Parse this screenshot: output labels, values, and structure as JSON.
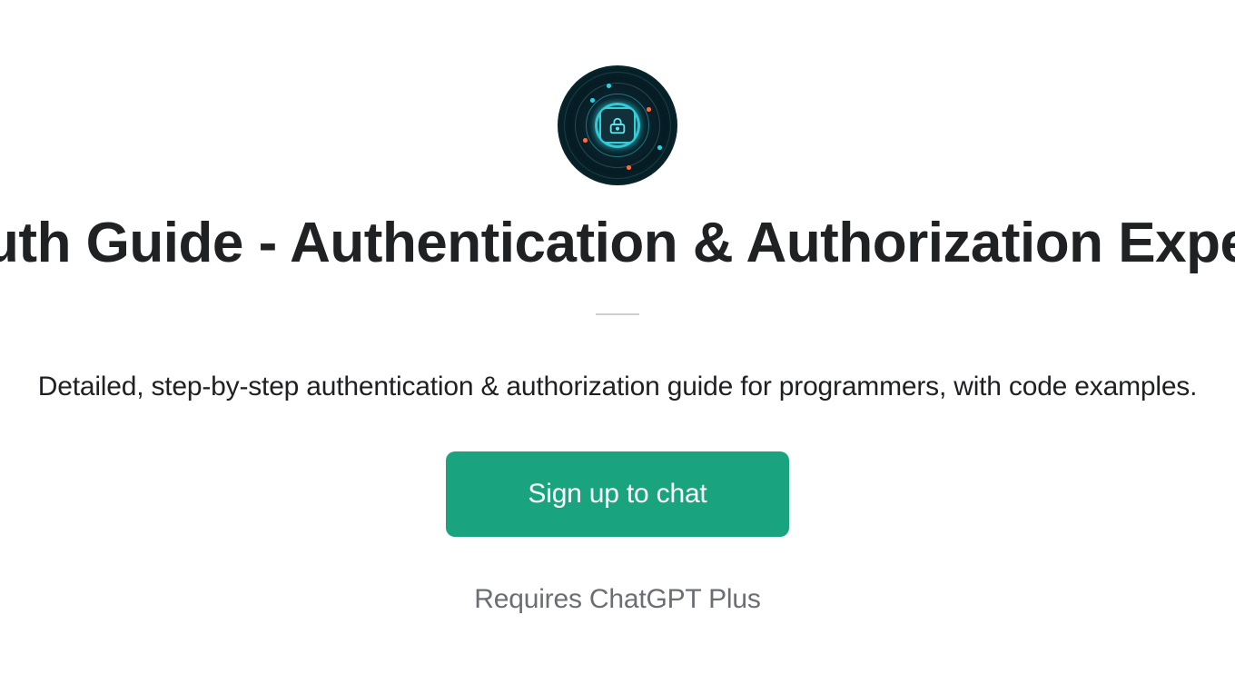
{
  "avatar": {
    "icon_name": "lock-icon"
  },
  "title": "Auth Guide - Authentication & Authorization Expert",
  "description": "Detailed, step-by-step authentication & authorization guide for programmers, with code examples.",
  "cta_label": "Sign up to chat",
  "requires_label": "Requires ChatGPT Plus"
}
